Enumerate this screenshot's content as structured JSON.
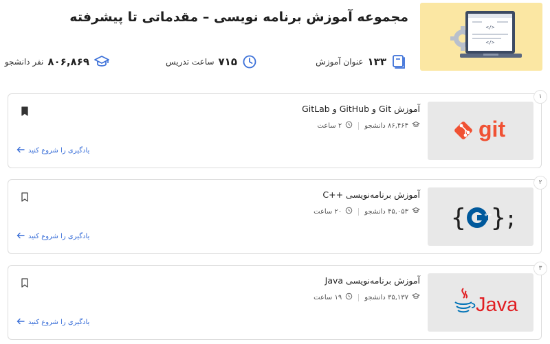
{
  "header": {
    "title": "مجموعه آموزش برنامه نویسی – مقدماتی تا پیشرفته",
    "thumbnail_icon": "laptop-code-gear",
    "stats": {
      "courses_value": "۱۳۳",
      "courses_label": "عنوان آموزش",
      "hours_value": "۷۱۵",
      "hours_label": "ساعت تدریس",
      "students_value": "۸۰۶,۸۶۹",
      "students_label": "نفر دانشجو"
    }
  },
  "courses": [
    {
      "index": "۱",
      "title": "آموزش Git و GitHub و GitLab",
      "students": "۸۶,۴۶۴ دانشجو",
      "duration": "۲ ساعت",
      "cta": "یادگیری را شروع کنید",
      "bookmarked": true,
      "thumb": {
        "logo_text": "git",
        "color": "#f05133"
      }
    },
    {
      "index": "۲",
      "title": "آموزش برنامه‌نویسی ++C",
      "students": "۴۵,۰۵۳ دانشجو",
      "duration": "۲۰ ساعت",
      "cta": "یادگیری را شروع کنید",
      "bookmarked": false,
      "thumb": {
        "logo_text": "{ C++ };",
        "color": "#00599c"
      }
    },
    {
      "index": "۳",
      "title": "آموزش برنامه‌نویسی Java",
      "students": "۳۵,۱۳۷ دانشجو",
      "duration": "۱۹ ساعت",
      "cta": "یادگیری را شروع کنید",
      "bookmarked": false,
      "thumb": {
        "logo_text": "Java",
        "color": "#e11e22"
      }
    }
  ],
  "colors": {
    "accent": "#3a6fd8",
    "hero_bg": "#fbe7a3",
    "card_border": "#dcdcdc"
  }
}
